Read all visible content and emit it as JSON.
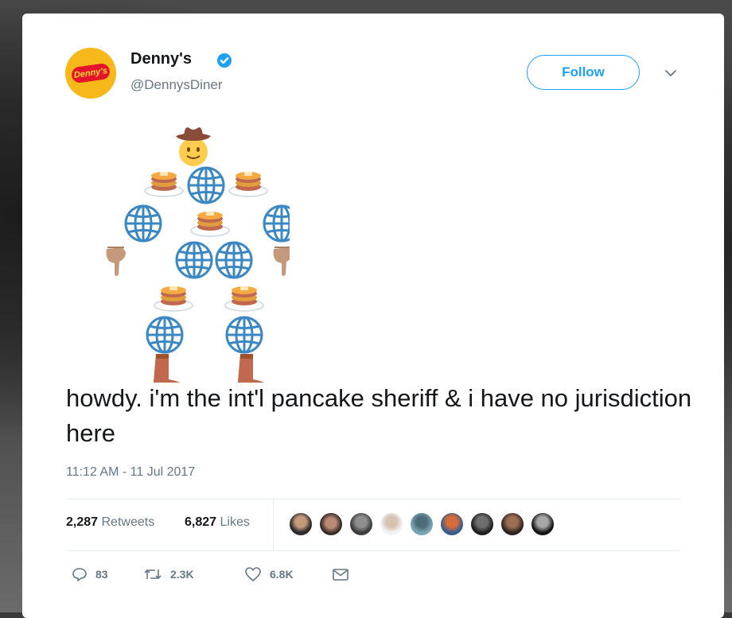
{
  "profile": {
    "name": "Denny's",
    "handle": "@DennysDiner",
    "avatar_text": "Denny's"
  },
  "follow_button": {
    "label": "Follow"
  },
  "tweet": {
    "text": "howdy. i'm the int'l pancake sheriff & i have no jurisdiction here",
    "timestamp": "11:12 AM - 11 Jul 2017"
  },
  "stats": {
    "retweets_count": "2,287",
    "retweets_label": "Retweets",
    "likes_count": "6,827",
    "likes_label": "Likes"
  },
  "actions": {
    "replies": "83",
    "retweets": "2.3K",
    "likes": "6.8K"
  },
  "colors": {
    "accent": "#1da1f2",
    "text": "#14171a",
    "muted": "#657786",
    "avatar_bg": "#f7b81a",
    "avatar_logo": "#e4152b"
  },
  "icons": [
    "verified-badge-icon",
    "chevron-down-icon",
    "reply-icon",
    "retweet-icon",
    "like-icon",
    "dm-icon",
    "cowboy-face-emoji",
    "pancakes-emoji",
    "globe-emoji",
    "pointing-down-emoji",
    "boot-emoji"
  ]
}
